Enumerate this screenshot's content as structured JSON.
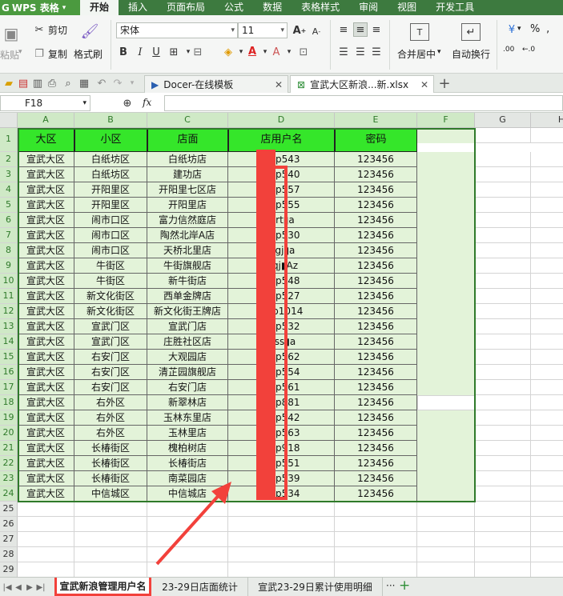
{
  "app": {
    "name": "WPS 表格"
  },
  "menu": [
    "开始",
    "插入",
    "页面布局",
    "公式",
    "数据",
    "表格样式",
    "审阅",
    "视图",
    "开发工具"
  ],
  "ribbon": {
    "paste": "粘贴",
    "cut": "剪切",
    "copy": "复制",
    "format_painter": "格式刷",
    "font_name": "宋体",
    "font_size": "11",
    "merge_center": "合并居中",
    "auto_wrap": "自动换行",
    "percent": "%",
    "dec_inc": ".00",
    "dec_dec": "←.0"
  },
  "tabs": {
    "docer": "Docer-在线模板",
    "file": "宣武大区新浪...新.xlsx"
  },
  "formula": {
    "cell_ref": "F18",
    "fx": "fx",
    "value": ""
  },
  "grid": {
    "columns": [
      "A",
      "B",
      "C",
      "D",
      "E",
      "F",
      "G",
      "H"
    ],
    "header": [
      "大区",
      "小区",
      "店面",
      "店用户名",
      "密码"
    ],
    "rows": [
      [
        "宣武大区",
        "白纸坊区",
        "白纸坊店",
        "l▮▮p543",
        "123456"
      ],
      [
        "宣武大区",
        "白纸坊区",
        "建功店",
        "l▮▮p540",
        "123456"
      ],
      [
        "宣武大区",
        "开阳里区",
        "开阳里七区店",
        "l▮▮p557",
        "123456"
      ],
      [
        "宣武大区",
        "开阳里区",
        "开阳里店",
        "l▮▮p555",
        "123456"
      ],
      [
        "宣武大区",
        "闹市口区",
        "富力信然庭店",
        "l▮rt▮a",
        "123456"
      ],
      [
        "宣武大区",
        "闹市口区",
        "陶然北岸A店",
        "l▮▮p530",
        "123456"
      ],
      [
        "宣武大区",
        "闹市口区",
        "天桥北里店",
        "l▮gj▮a",
        "123456"
      ],
      [
        "宣武大区",
        "牛街区",
        "牛街旗舰店",
        "l▮qj▮Az",
        "123456"
      ],
      [
        "宣武大区",
        "牛街区",
        "新牛街店",
        "l▮▮p548",
        "123456"
      ],
      [
        "宣武大区",
        "新文化街区",
        "西单金牌店",
        "l▮▮p527",
        "123456"
      ],
      [
        "宣武大区",
        "新文化街区",
        "新文化街王牌店",
        "l▮▮p1014",
        "123456"
      ],
      [
        "宣武大区",
        "宣武门区",
        "宣武门店",
        "l▮▮p532",
        "123456"
      ],
      [
        "宣武大区",
        "宣武门区",
        "庄胜社区店",
        "l▮ss▮a",
        "123456"
      ],
      [
        "宣武大区",
        "右安门区",
        "大观园店",
        "l▮▮p562",
        "123456"
      ],
      [
        "宣武大区",
        "右安门区",
        "清芷园旗舰店",
        "l▮▮p554",
        "123456"
      ],
      [
        "宣武大区",
        "右安门区",
        "右安门店",
        "l▮▮p561",
        "123456"
      ],
      [
        "宣武大区",
        "右外区",
        "新翠林店",
        "l▮▮p881",
        "123456"
      ],
      [
        "宣武大区",
        "右外区",
        "玉林东里店",
        "l▮▮p542",
        "123456"
      ],
      [
        "宣武大区",
        "右外区",
        "玉林里店",
        "l▮▮p563",
        "123456"
      ],
      [
        "宣武大区",
        "长椿街区",
        "槐柏树店",
        "l▮▮p918",
        "123456"
      ],
      [
        "宣武大区",
        "长椿街区",
        "长椿街店",
        "l▮▮p551",
        "123456"
      ],
      [
        "宣武大区",
        "长椿街区",
        "南菜园店",
        "l▮▮p539",
        "123456"
      ],
      [
        "宣武大区",
        "中信城区",
        "中信城店",
        "l▮▮p534",
        "123456"
      ]
    ],
    "row_numbers": [
      "1",
      "2",
      "3",
      "4",
      "5",
      "6",
      "7",
      "8",
      "9",
      "10",
      "11",
      "12",
      "13",
      "14",
      "15",
      "16",
      "17",
      "18",
      "19",
      "20",
      "21",
      "22",
      "23",
      "24",
      "25",
      "26",
      "27",
      "28",
      "29"
    ]
  },
  "sheets": [
    "宣武新浪管理用户名",
    "23-29日店面统计",
    "宣武23-29日累计使用明细"
  ],
  "sheet_more": "···",
  "sheet_add": "+",
  "colors": {
    "green_menu": "#3d7a3f",
    "header_fill": "#35e62a",
    "fill": "#e3f3d9",
    "annotation": "#f2413b"
  }
}
